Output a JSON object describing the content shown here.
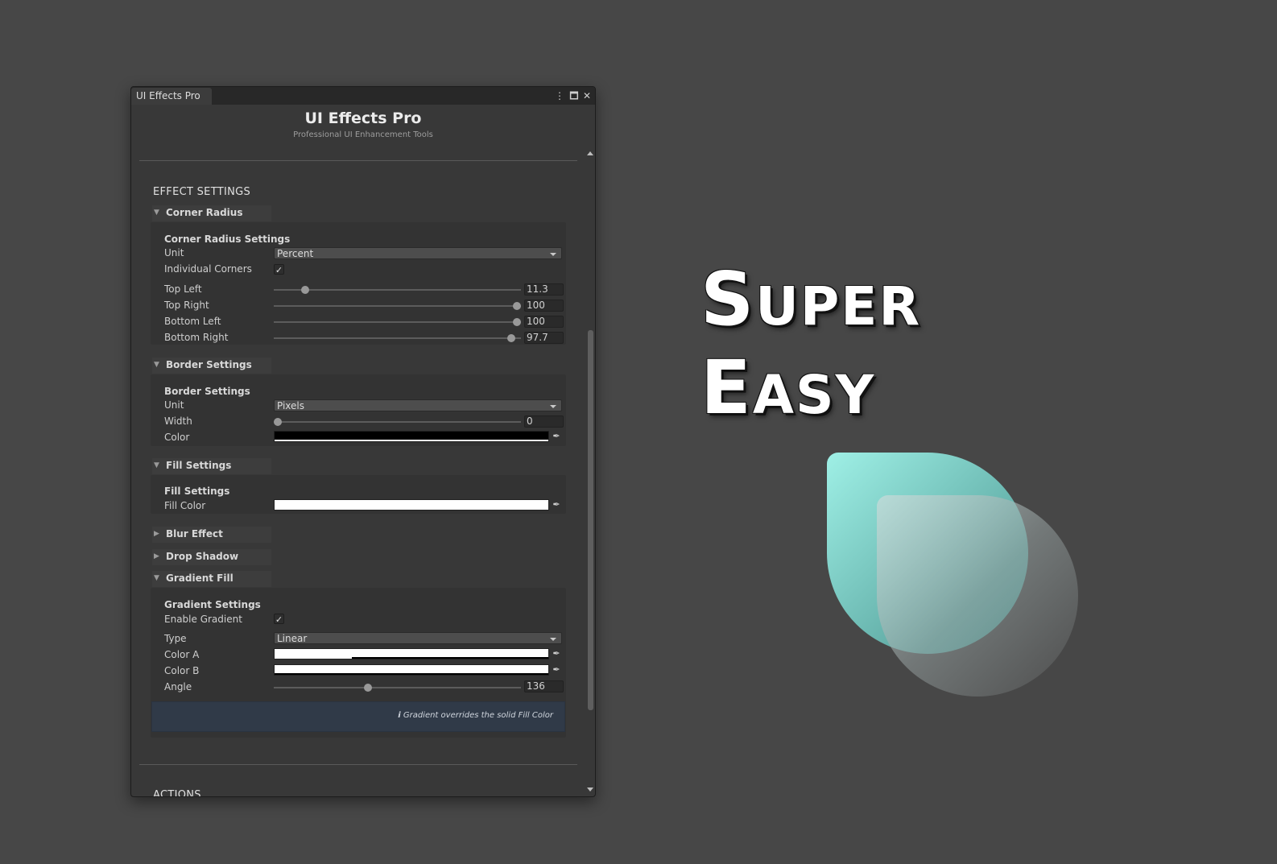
{
  "window": {
    "tab_title": "UI Effects Pro",
    "menu_icon": "kebab-menu-icon",
    "maximize_icon": "maximize-icon",
    "close_icon": "close-icon",
    "title": "UI Effects Pro",
    "subtitle": "Professional UI Enhancement Tools"
  },
  "effect_settings": {
    "heading": "EFFECT SETTINGS",
    "corner_radius": {
      "foldout": "Corner Radius",
      "box_title": "Corner Radius Settings",
      "unit_label": "Unit",
      "unit_value": "Percent",
      "individual_label": "Individual Corners",
      "individual_checked": true,
      "top_left_label": "Top Left",
      "top_left": "11.3",
      "top_right_label": "Top Right",
      "top_right": "100",
      "bottom_left_label": "Bottom Left",
      "bottom_left": "100",
      "bottom_right_label": "Bottom Right",
      "bottom_right": "97.7",
      "slider_range": [
        0,
        100
      ]
    },
    "border": {
      "foldout": "Border Settings",
      "box_title": "Border Settings",
      "unit_label": "Unit",
      "unit_value": "Pixels",
      "width_label": "Width",
      "width_value": "0",
      "width_range": [
        0,
        100
      ],
      "color_label": "Color",
      "color": "#000000"
    },
    "fill": {
      "foldout": "Fill Settings",
      "box_title": "Fill Settings",
      "fill_color_label": "Fill Color",
      "fill_color": "#ffffff"
    },
    "blur": {
      "foldout": "Blur Effect"
    },
    "drop_shadow": {
      "foldout": "Drop Shadow"
    },
    "gradient": {
      "foldout": "Gradient Fill",
      "box_title": "Gradient Settings",
      "enable_label": "Enable Gradient",
      "enable_checked": true,
      "type_label": "Type",
      "type_value": "Linear",
      "color_a_label": "Color A",
      "color_a": "#ffffff",
      "color_b_label": "Color B",
      "color_b": "#ffffff",
      "angle_label": "Angle",
      "angle_value": "136",
      "angle_range": [
        0,
        360
      ],
      "info": "Gradient overrides the solid Fill Color"
    }
  },
  "actions_heading": "ACTIONS",
  "promo": {
    "line1_initial": "S",
    "line1_rest": "UPER",
    "line2_initial": "E",
    "line2_rest": "ASY"
  }
}
